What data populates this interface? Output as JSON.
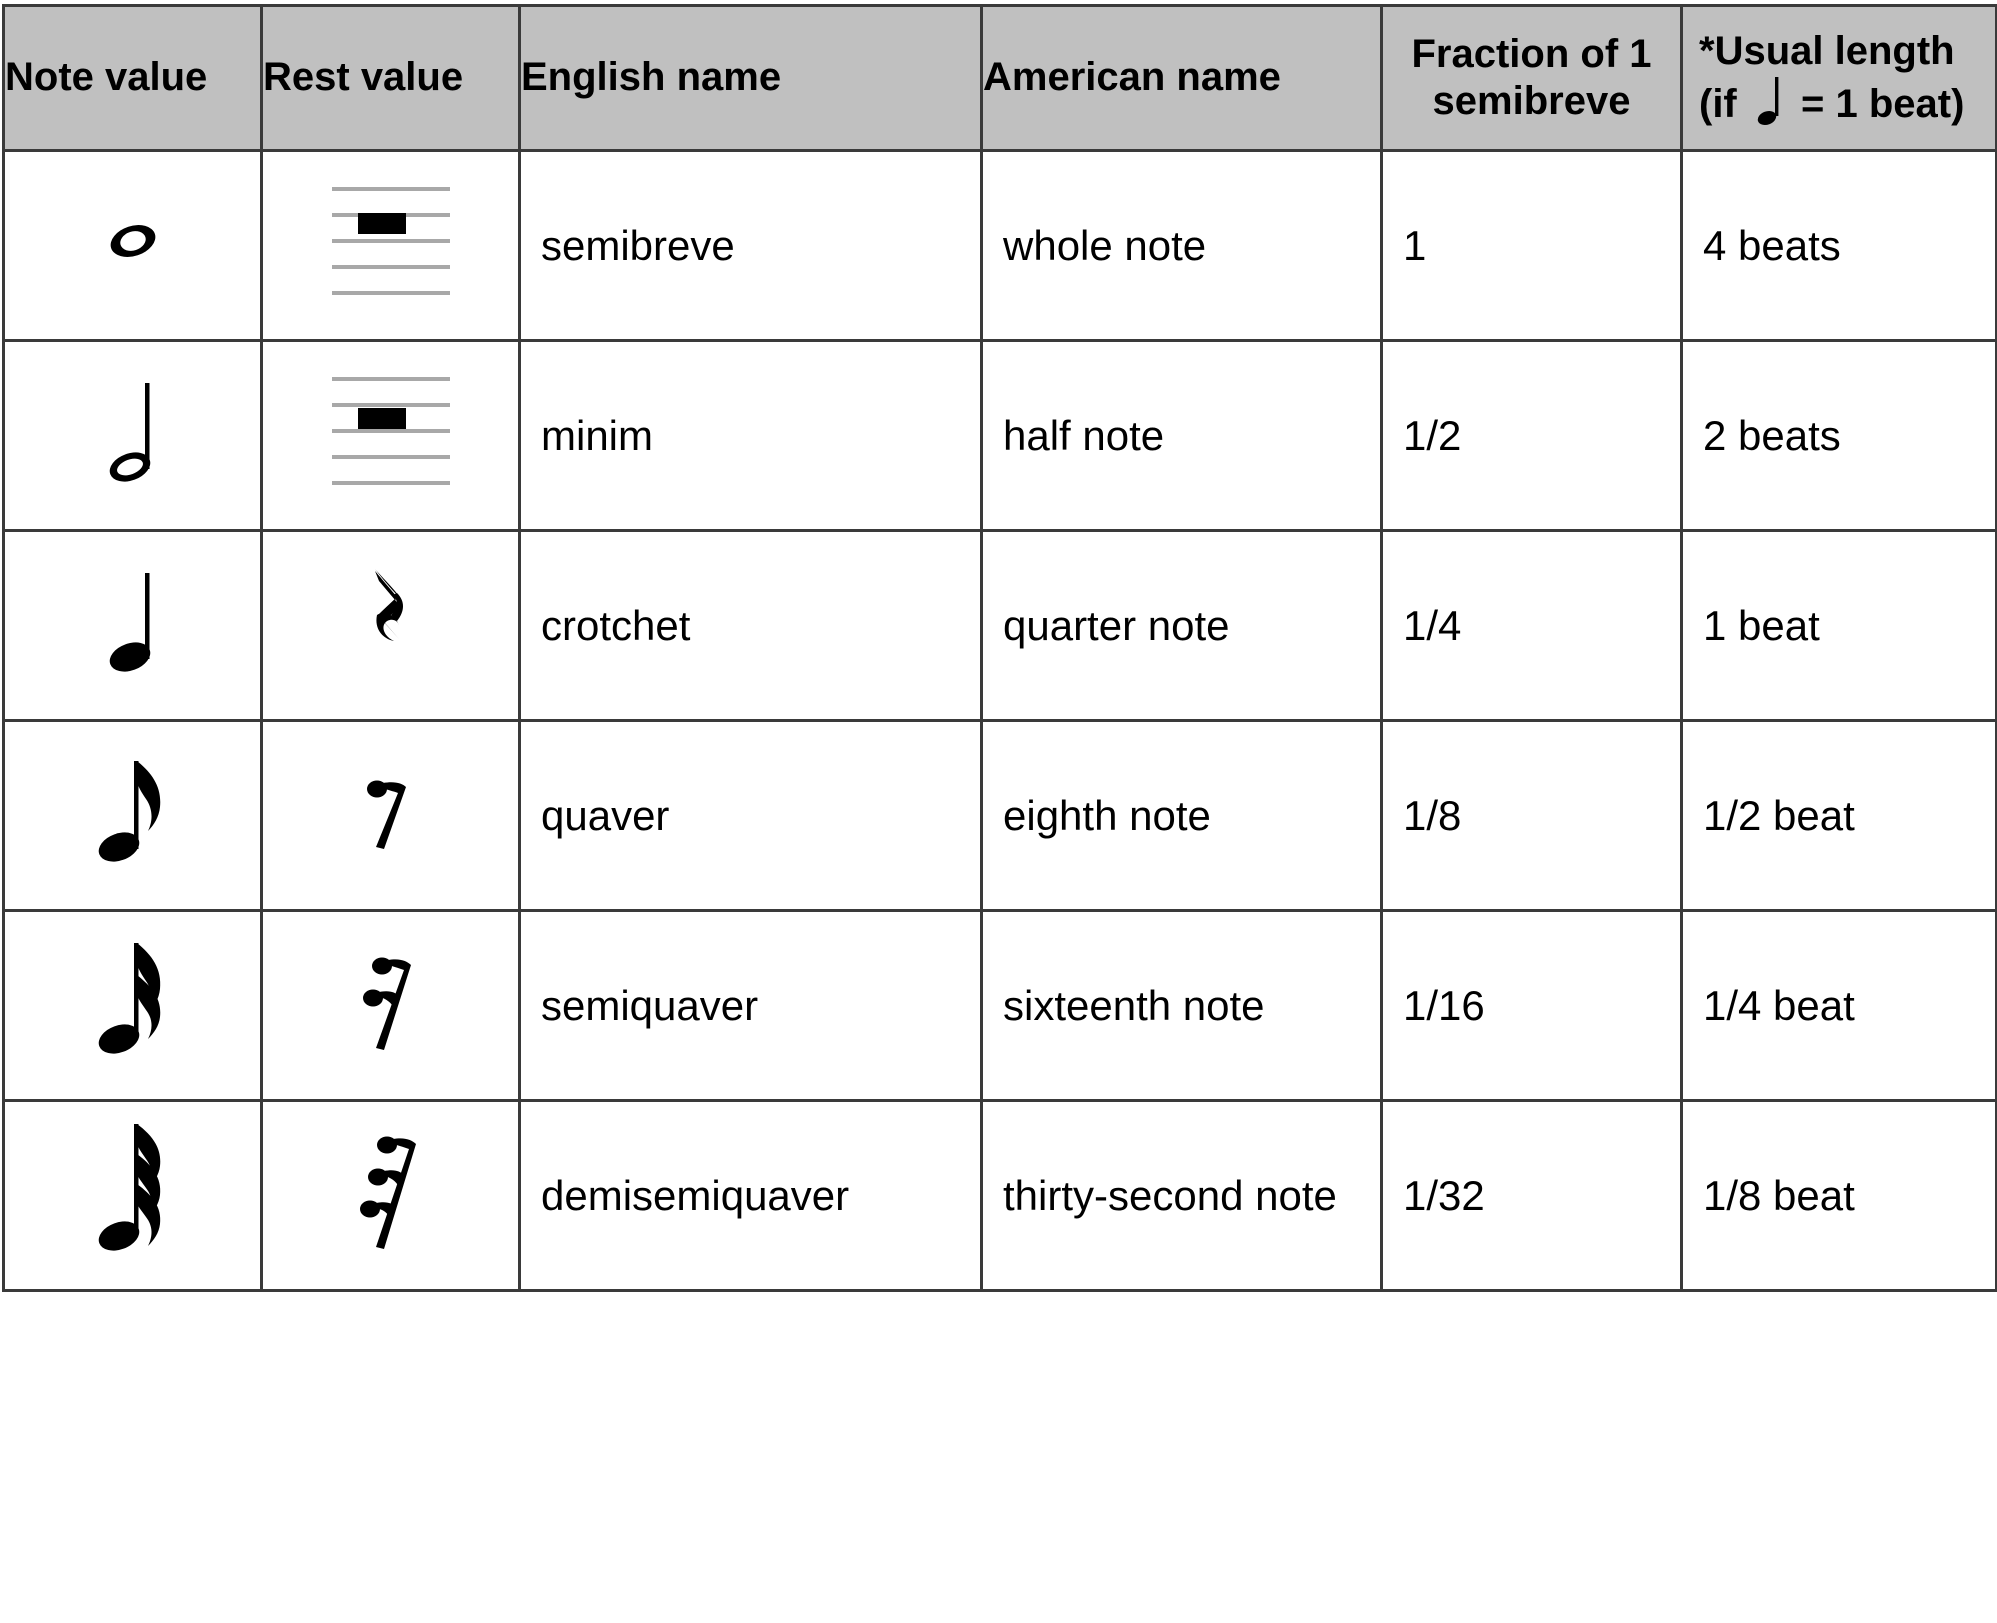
{
  "table": {
    "headers": [
      {
        "id": "note-value",
        "label": "Note value"
      },
      {
        "id": "rest-value",
        "label": "Rest value"
      },
      {
        "id": "english-name",
        "label": "English name"
      },
      {
        "id": "american-name",
        "label": "American name"
      },
      {
        "id": "fraction",
        "label_line1": "Fraction of 1",
        "label_line2": "semibreve"
      },
      {
        "id": "usual-length",
        "label_line1": "*Usual length",
        "label_line2_pre": "(if",
        "label_line2_post": "= 1 beat)",
        "note_icon": "crotchet-note-icon"
      }
    ],
    "rows": [
      {
        "note_icon": "semibreve-note-icon",
        "rest_icon": "semibreve-rest-icon",
        "english_name": "semibreve",
        "american_name": "whole note",
        "fraction": "1",
        "usual_length": "4 beats"
      },
      {
        "note_icon": "minim-note-icon",
        "rest_icon": "minim-rest-icon",
        "english_name": "minim",
        "american_name": "half note",
        "fraction": "1/2",
        "usual_length": "2 beats"
      },
      {
        "note_icon": "crotchet-note-icon",
        "rest_icon": "crotchet-rest-icon",
        "english_name": "crotchet",
        "american_name": "quarter note",
        "fraction": "1/4",
        "usual_length": "1 beat"
      },
      {
        "note_icon": "quaver-note-icon",
        "rest_icon": "quaver-rest-icon",
        "english_name": "quaver",
        "american_name": "eighth note",
        "fraction": "1/8",
        "usual_length": "1/2 beat"
      },
      {
        "note_icon": "semiquaver-note-icon",
        "rest_icon": "semiquaver-rest-icon",
        "english_name": "semiquaver",
        "american_name": "sixteenth note",
        "fraction": "1/16",
        "usual_length": "1/4 beat"
      },
      {
        "note_icon": "demisemiquaver-note-icon",
        "rest_icon": "demisemiquaver-rest-icon",
        "english_name": "demisemiquaver",
        "american_name": "thirty-second note",
        "fraction": "1/32",
        "usual_length": "1/8 beat"
      }
    ]
  },
  "colors": {
    "header_background": "#c0c0c0",
    "border": "#3a3a3a",
    "header_rule": "#111111",
    "staff_line": "#a8a8a8",
    "ink": "#000000",
    "page_background": "#ffffff"
  }
}
